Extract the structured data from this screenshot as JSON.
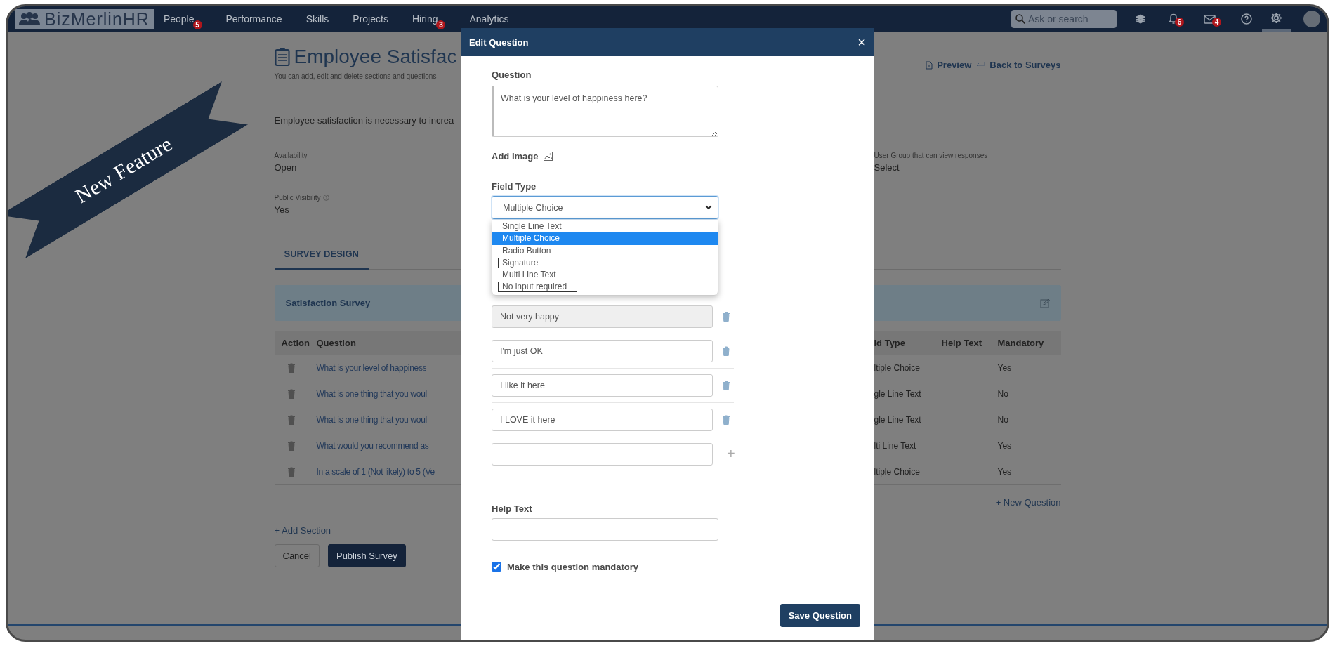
{
  "topbar": {
    "logo": "BizMerlinHR",
    "nav": [
      {
        "label": "People",
        "badge": "5"
      },
      {
        "label": "Performance"
      },
      {
        "label": "Skills"
      },
      {
        "label": "Projects"
      },
      {
        "label": "Hiring",
        "badge": "3"
      },
      {
        "label": "Analytics"
      }
    ],
    "search": {
      "placeholder": "Ask or search"
    },
    "notifications_badge": "6",
    "messages_badge": "4",
    "settings_selected": true
  },
  "banner": {
    "text": "New Feature"
  },
  "page": {
    "title": "Employee Satisfac",
    "subtitle": "You can add, edit and delete sections and questions",
    "links": [
      "Preview",
      "Back to Surveys"
    ],
    "description": "Employee  satisfaction is necessary to increa",
    "fields": [
      {
        "label": "Availability",
        "value": "Open",
        "help": false
      },
      {
        "label": "Public Visibility",
        "value": "Yes",
        "help": true
      }
    ],
    "right_field": {
      "label": "User Group that can view responses",
      "value": "Select"
    },
    "tabs": [
      {
        "label": "SURVEY DESIGN",
        "selected": true
      }
    ],
    "section": {
      "title": "Satisfaction Survey"
    },
    "table": {
      "columns_left": [
        "Action",
        "Question"
      ],
      "columns_right": [
        "ld Type",
        "Help Text",
        "Mandatory"
      ],
      "rows": [
        {
          "question": "What is your level of happiness",
          "field_type": "ltiple Choice",
          "mandatory": "Yes"
        },
        {
          "question": "What is one thing that you woul",
          "field_type": "gle Line Text",
          "mandatory": "No"
        },
        {
          "question": "What is one thing that you woul",
          "field_type": "gle Line Text",
          "mandatory": "No"
        },
        {
          "question": "What would you recommend as",
          "field_type": "lti Line Text",
          "mandatory": "Yes"
        },
        {
          "question": "In a scale of 1 (Not likely) to 5 (Ve",
          "field_type": "ltiple Choice",
          "mandatory": "Yes"
        }
      ]
    },
    "add_section": "+ Add Section",
    "new_question": "+ New Question",
    "buttons": [
      "Cancel",
      "Publish Survey"
    ]
  },
  "modal": {
    "title": "Edit Question",
    "close": "×",
    "add_choice": "+",
    "question_label": "Question",
    "question_value": "What is your level of happiness here?",
    "add_image": "Add Image",
    "field_type_label": "Field Type",
    "field_type_value": "Multiple Choice",
    "options": [
      {
        "label": "Single Line Text",
        "selected": false,
        "highlighted": false
      },
      {
        "label": "Multiple Choice",
        "selected": true,
        "highlighted": false
      },
      {
        "label": "Radio Button",
        "selected": false,
        "highlighted": false
      },
      {
        "label": "Signature",
        "selected": false,
        "highlighted": true
      },
      {
        "label": "Multi Line Text",
        "selected": false,
        "highlighted": false
      },
      {
        "label": "No input required",
        "selected": false,
        "highlighted": true
      }
    ],
    "choices": [
      {
        "value": "Not very happy",
        "disabled": true
      },
      {
        "value": "I'm just OK",
        "disabled": false
      },
      {
        "value": "I like it here",
        "disabled": false
      },
      {
        "value": "I LOVE it here",
        "disabled": false
      }
    ],
    "help_text_label": "Help Text",
    "mandatory": {
      "label": "Make this question mandatory",
      "checked": true
    },
    "save": "Save Question"
  }
}
